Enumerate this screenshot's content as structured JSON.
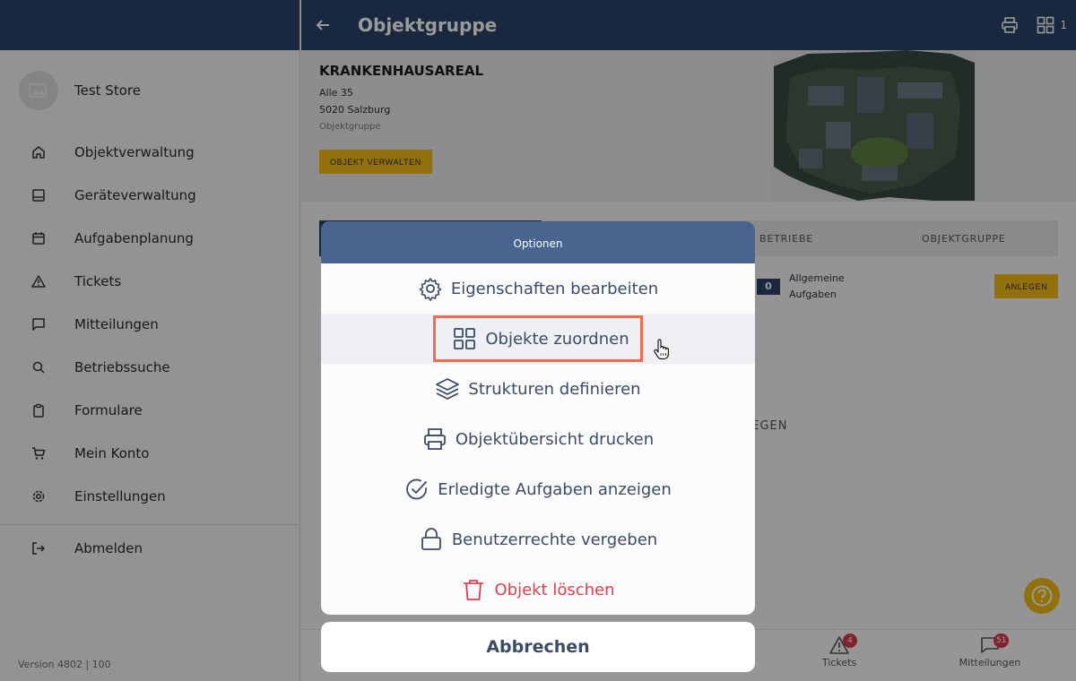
{
  "sidebar": {
    "store_name": "Test Store",
    "items": [
      {
        "label": "Objektverwaltung",
        "icon": "home-icon"
      },
      {
        "label": "Geräteverwaltung",
        "icon": "device-icon"
      },
      {
        "label": "Aufgabenplanung",
        "icon": "calendar-icon"
      },
      {
        "label": "Tickets",
        "icon": "warning-icon"
      },
      {
        "label": "Mitteilungen",
        "icon": "chat-icon"
      },
      {
        "label": "Betriebssuche",
        "icon": "search-icon"
      },
      {
        "label": "Formulare",
        "icon": "clipboard-icon"
      },
      {
        "label": "Mein Konto",
        "icon": "cart-icon"
      },
      {
        "label": "Einstellungen",
        "icon": "gear-icon"
      }
    ],
    "logout_label": "Abmelden",
    "version": "Version 4802  | 100"
  },
  "header": {
    "title": "Objektgruppe",
    "grid_count": "1"
  },
  "object": {
    "name": "KRANKENHAUSAREAL",
    "street": "Alle 35",
    "city": "5020 Salzburg",
    "type": "Objektgruppe",
    "manage_button": "OBJEKT VERWALTEN"
  },
  "tabs": {
    "tab_betriebe": "BETRIEBE",
    "tab_objektgruppe": "OBJEKTGRUPPE"
  },
  "tasks": {
    "count": "0",
    "label_line1": "Allgemeine",
    "label_line2": "Aufgaben",
    "create_button": "ANLEGEN",
    "partial_text": "LEGEN"
  },
  "bottom_nav": {
    "tickets_label": "Tickets",
    "tickets_badge": "4",
    "messages_label": "Mitteilungen",
    "messages_badge": "51"
  },
  "options_sheet": {
    "title": "Optionen",
    "options": [
      {
        "label": "Eigenschaften bearbeiten",
        "icon": "gear-icon"
      },
      {
        "label": "Objekte zuordnen",
        "icon": "grid-icon"
      },
      {
        "label": "Strukturen definieren",
        "icon": "layers-icon"
      },
      {
        "label": "Objektübersicht drucken",
        "icon": "printer-icon"
      },
      {
        "label": "Erledigte Aufgaben anzeigen",
        "icon": "check-circle-icon"
      },
      {
        "label": "Benutzerrechte vergeben",
        "icon": "lock-icon"
      },
      {
        "label": "Objekt löschen",
        "icon": "trash-icon"
      }
    ],
    "cancel_label": "Abbrechen"
  },
  "colors": {
    "primary": "#2b4468",
    "sheet_header": "#4a6490",
    "accent_yellow": "#f4bd14",
    "danger": "#e23e4e",
    "highlight_frame": "#f26a50"
  }
}
